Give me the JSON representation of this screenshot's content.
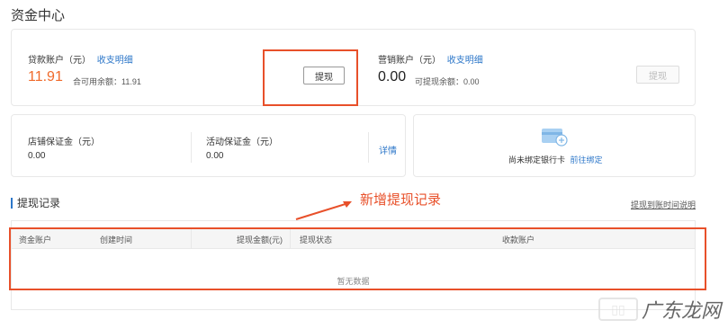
{
  "page_title": "资金中心",
  "loan_account": {
    "label": "贷款账户（元）",
    "detail_link": "收支明细",
    "amount": "11.91",
    "available": "合可用余额：11.91",
    "withdraw_button": "提现"
  },
  "marketing_account": {
    "label": "营销账户（元）",
    "detail_link": "收支明细",
    "amount": "0.00",
    "available": "可提现余额：0.00",
    "withdraw_button": "提现"
  },
  "deposits": {
    "store_label": "店铺保证金（元）",
    "store_amount": "0.00",
    "activity_label": "活动保证金（元）",
    "activity_amount": "0.00",
    "detail_link": "详情"
  },
  "bank": {
    "status_text": "尚未绑定银行卡",
    "bind_link": "前往绑定"
  },
  "records": {
    "title": "提现记录",
    "annotation": "新增提现记录",
    "arrival_link": "提现到账时间说明",
    "columns": [
      "资金账户",
      "创建时间",
      "提现金额(元)",
      "提现状态",
      "收款账户"
    ],
    "empty_text": "暂无数据"
  },
  "watermark": {
    "text": "广东龙网"
  },
  "colors": {
    "accent": "#2d77c9",
    "amount_orange": "#f06a2b",
    "annotation_red": "#e8502a"
  }
}
